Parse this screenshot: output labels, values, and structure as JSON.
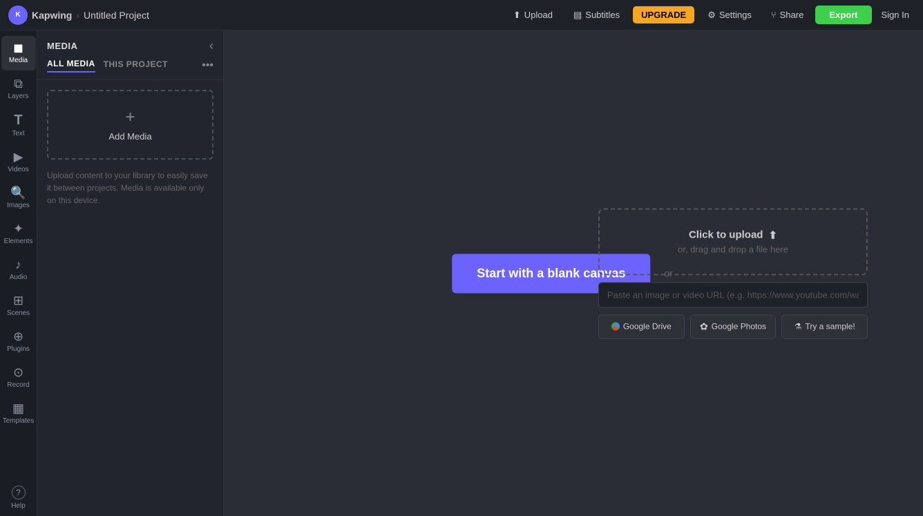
{
  "topbar": {
    "brand": "Kapwing",
    "separator": "›",
    "project": "Untitled Project",
    "upload_label": "Upload",
    "subtitles_label": "Subtitles",
    "upgrade_label": "UPGRADE",
    "settings_label": "Settings",
    "share_label": "Share",
    "export_label": "Export",
    "signin_label": "Sign In"
  },
  "left_nav": {
    "items": [
      {
        "id": "media",
        "label": "Media",
        "icon": "⬛"
      },
      {
        "id": "layers",
        "label": "Layers",
        "icon": "◧"
      },
      {
        "id": "text",
        "label": "Text",
        "icon": "T"
      },
      {
        "id": "videos",
        "label": "Videos",
        "icon": "▶"
      },
      {
        "id": "images",
        "label": "Images",
        "icon": "🔍"
      },
      {
        "id": "elements",
        "label": "Elements",
        "icon": "✦"
      },
      {
        "id": "audio",
        "label": "Audio",
        "icon": "♪"
      },
      {
        "id": "scenes",
        "label": "Scenes",
        "icon": "⧉"
      },
      {
        "id": "plugins",
        "label": "Plugins",
        "icon": "⊞"
      },
      {
        "id": "record",
        "label": "Record",
        "icon": "⊙"
      },
      {
        "id": "templates",
        "label": "Templates",
        "icon": "▦"
      }
    ],
    "help": {
      "label": "Help",
      "icon": "?"
    }
  },
  "media_panel": {
    "title": "MEDIA",
    "tabs": [
      {
        "id": "all_media",
        "label": "ALL MEDIA",
        "active": true
      },
      {
        "id": "this_project",
        "label": "THIS PROJECT",
        "active": false
      }
    ],
    "add_media_label": "Add Media",
    "help_text": "Upload content to your library to easily save it between projects. Media is available only on this device."
  },
  "canvas": {
    "blank_canvas_label": "Start with a blank canvas",
    "or_label": "or"
  },
  "upload_area": {
    "click_to_upload": "Click to upload",
    "drag_drop": "or, drag and drop a file here",
    "url_placeholder": "Paste an image or video URL (e.g. https://www.youtube.com/watch?v=C",
    "google_drive_label": "Google Drive",
    "google_photos_label": "Google Photos",
    "try_sample_label": "Try a sample!"
  }
}
